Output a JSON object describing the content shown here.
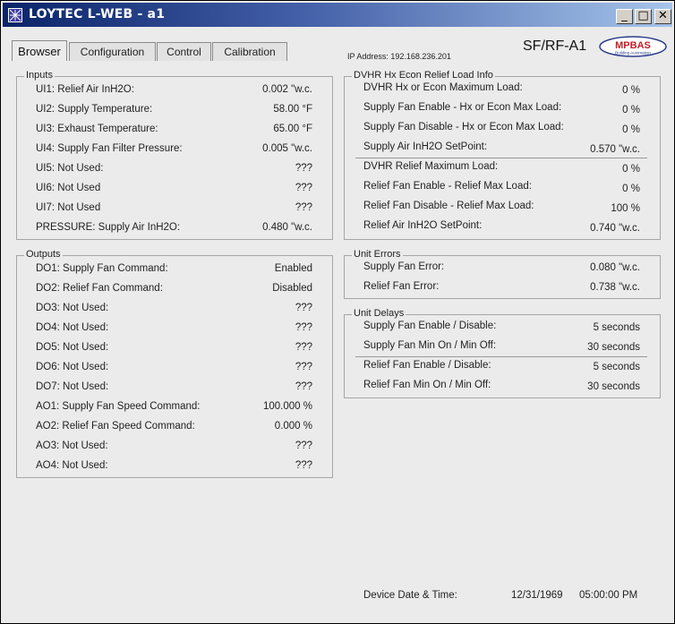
{
  "window": {
    "title": "LOYTEC L-WEB - a1",
    "minimize": "_",
    "maximize": "□",
    "close": "✕"
  },
  "tabs": [
    "Browser",
    "Configuration",
    "Control",
    "Calibration"
  ],
  "ip_address": "IP Address: 192.168.236.201",
  "unit_name": "SF/RF-A1",
  "logo": {
    "brand": "MPBAS",
    "tagline": "Building Automation"
  },
  "inputs": {
    "title": "Inputs",
    "rows": [
      {
        "label": "UI1: Relief Air InH2O:",
        "value": "0.002 \"w.c."
      },
      {
        "label": "UI2: Supply Temperature:",
        "value": "58.00 °F"
      },
      {
        "label": "UI3: Exhaust Temperature:",
        "value": "65.00 °F"
      },
      {
        "label": "UI4: Supply Fan Filter Pressure:",
        "value": "0.005 \"w.c."
      },
      {
        "label": "UI5: Not Used:",
        "value": "???"
      },
      {
        "label": "UI6: Not Used",
        "value": "???"
      },
      {
        "label": "UI7: Not Used",
        "value": "???"
      },
      {
        "label": "PRESSURE: Supply Air InH2O:",
        "value": "0.480 \"w.c."
      }
    ]
  },
  "outputs": {
    "title": "Outputs",
    "rows": [
      {
        "label": "DO1: Supply Fan Command:",
        "value": "Enabled"
      },
      {
        "label": "DO2: Relief Fan Command:",
        "value": "Disabled"
      },
      {
        "label": "DO3: Not Used:",
        "value": "???"
      },
      {
        "label": "DO4: Not Used:",
        "value": "???"
      },
      {
        "label": "DO5: Not Used:",
        "value": "???"
      },
      {
        "label": "DO6: Not Used:",
        "value": "???"
      },
      {
        "label": "DO7: Not Used:",
        "value": "???"
      },
      {
        "label": "AO1: Supply Fan Speed Command:",
        "value": "100.000 %"
      },
      {
        "label": "AO2: Relief Fan Speed Command:",
        "value": "0.000 %"
      },
      {
        "label": "AO3: Not Used:",
        "value": "???"
      },
      {
        "label": "AO4: Not Used:",
        "value": "???"
      }
    ]
  },
  "load_info": {
    "title": "DVHR Hx  Econ  Relief  Load Info",
    "rows": [
      {
        "label": "DVHR Hx or Econ Maximum Load:",
        "value": "0 %"
      },
      {
        "label": "Supply Fan Enable - Hx or Econ Max Load:",
        "value": "0 %"
      },
      {
        "label": "Supply Fan Disable - Hx or Econ Max Load:",
        "value": "0 %"
      },
      {
        "label": "Supply Air InH2O SetPoint:",
        "value": "0.570 \"w.c."
      },
      {
        "label": "DVHR Relief Maximum Load:",
        "value": "0 %"
      },
      {
        "label": "Relief Fan Enable - Relief Max Load:",
        "value": "0 %"
      },
      {
        "label": "Relief Fan Disable - Relief Max Load:",
        "value": "100 %"
      },
      {
        "label": "Relief Air InH2O SetPoint:",
        "value": "0.740 \"w.c."
      }
    ]
  },
  "unit_errors": {
    "title": "Unit Errors",
    "rows": [
      {
        "label": "Supply Fan Error:",
        "value": "0.080 \"w.c."
      },
      {
        "label": "Relief Fan Error:",
        "value": "0.738 \"w.c."
      }
    ]
  },
  "unit_delays": {
    "title": "Unit Delays",
    "rows": [
      {
        "label": "Supply Fan Enable / Disable:",
        "value": "5 seconds"
      },
      {
        "label": "Supply Fan Min On / Min Off:",
        "value": "30 seconds"
      },
      {
        "label": "Relief Fan Enable / Disable:",
        "value": "5 seconds"
      },
      {
        "label": "Relief Fan Min On / Min Off:",
        "value": "30 seconds"
      }
    ]
  },
  "status": {
    "label": "Device Date & Time:",
    "date": "12/31/1969",
    "time": "05:00:00 PM"
  }
}
